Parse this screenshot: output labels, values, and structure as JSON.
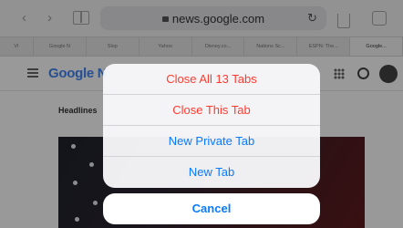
{
  "browser": {
    "address": "news.google.com",
    "tabs": [
      "VI",
      "Google N",
      "Slop",
      "Yahoo",
      "Disney.co...",
      "Nations Sc...",
      "ESPN: The...",
      "Google..."
    ],
    "site_logo": "Google N",
    "headline": "Headlines"
  },
  "action_sheet": {
    "close_all": "Close All 13 Tabs",
    "close_this": "Close This Tab",
    "new_private": "New Private Tab",
    "new_tab": "New Tab",
    "cancel": "Cancel"
  },
  "colors": {
    "destructive": "#ff3b30",
    "accent": "#0a7aff"
  }
}
